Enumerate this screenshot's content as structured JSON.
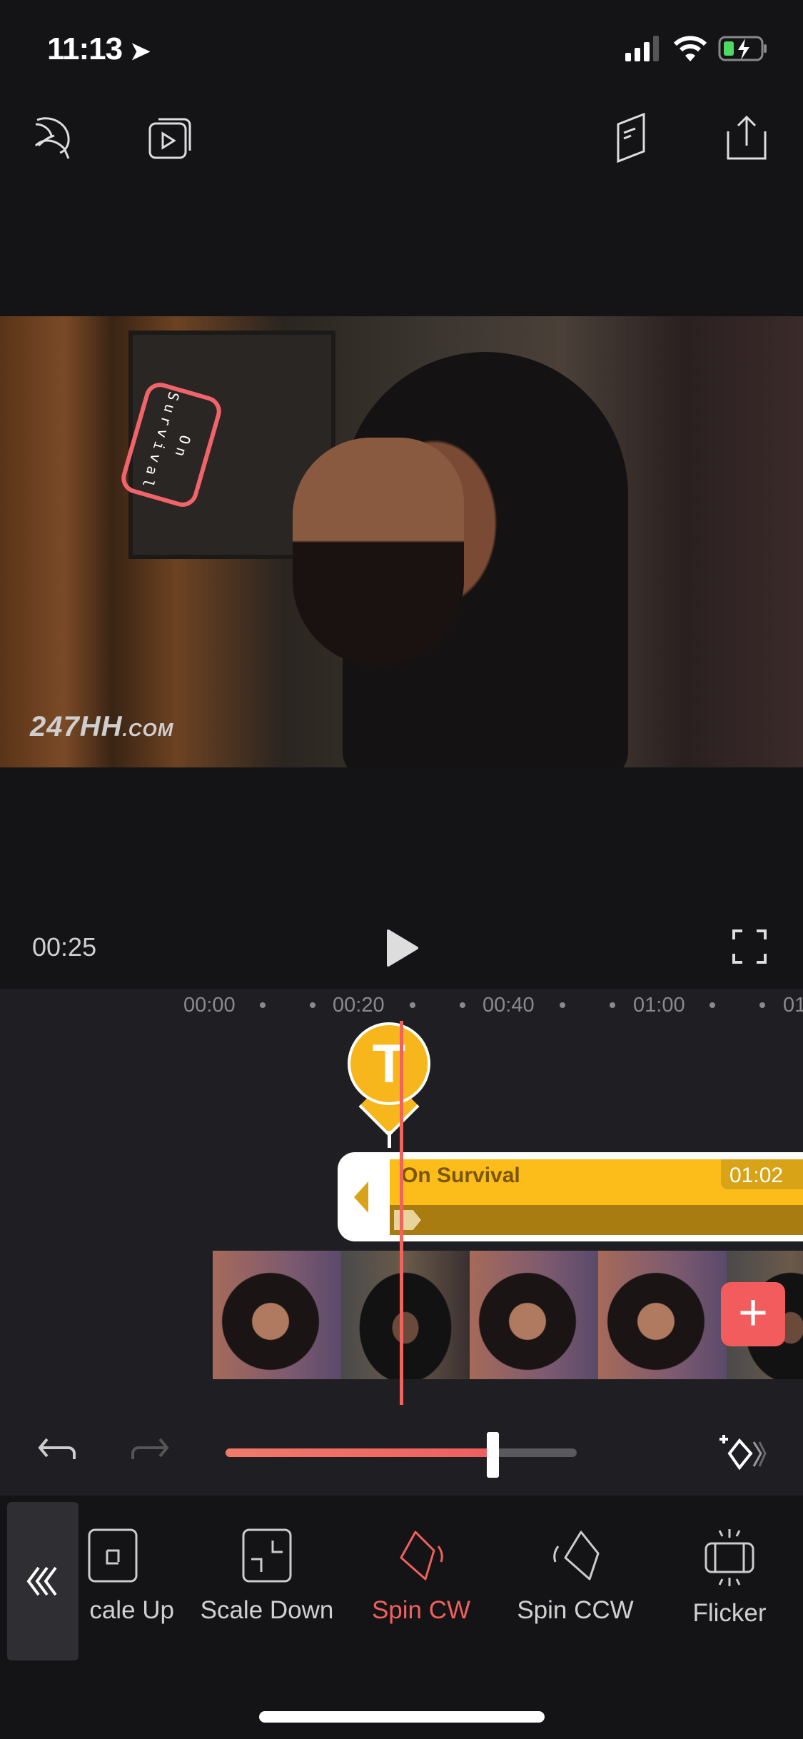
{
  "status_bar": {
    "time": "11:13",
    "signal_icon": "cellular-signal-icon",
    "wifi_icon": "wifi-icon",
    "battery_icon": "battery-charging-icon",
    "battery_color": "#4cd964"
  },
  "toolbar": {
    "left": [
      "logo-icon",
      "preview-icon"
    ],
    "right": [
      "guide-book-icon",
      "share-icon"
    ]
  },
  "video": {
    "sticker_text": "On Survival",
    "watermark": "247HH",
    "watermark_suffix": ".COM"
  },
  "player": {
    "current_time": "00:25",
    "play_icon": "play-icon",
    "fullscreen_icon": "fullscreen-icon"
  },
  "timeline": {
    "ruler": [
      "00:00",
      "00:20",
      "00:40",
      "01:00",
      "01"
    ],
    "marker_letter": "T",
    "text_clip": {
      "title": "On  Survival",
      "duration": "01:02",
      "color": "#fcbc1a"
    },
    "add_clip_label": "+",
    "accent": "#f0645c"
  },
  "controls": {
    "undo_icon": "undo-icon",
    "redo_icon": "redo-icon",
    "slider_value_percent": 76,
    "keyframe_icon": "add-keyframe-icon"
  },
  "animations": {
    "collapse_icon": "chevrons-left-icon",
    "items": [
      {
        "label": "cale Up",
        "icon": "scale-up-icon"
      },
      {
        "label": "Scale Down",
        "icon": "scale-down-icon"
      },
      {
        "label": "Spin CW",
        "icon": "spin-cw-icon",
        "selected": true
      },
      {
        "label": "Spin CCW",
        "icon": "spin-ccw-icon"
      },
      {
        "label": "Flicker",
        "icon": "flicker-icon"
      }
    ]
  }
}
